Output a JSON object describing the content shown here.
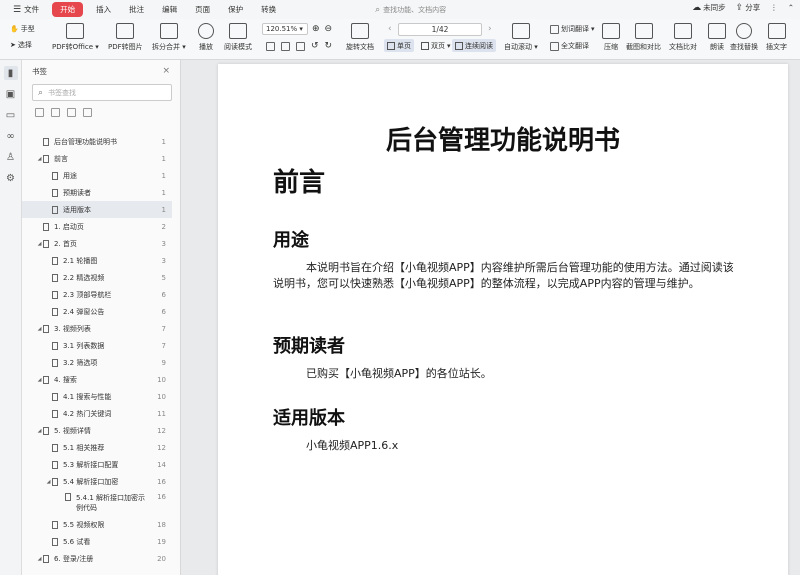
{
  "menubar": {
    "items": [
      "文件",
      "开始",
      "插入",
      "批注",
      "编辑",
      "页面",
      "保护",
      "转换"
    ],
    "active_index": 1,
    "search_text": "查找功能、文档内容",
    "sync_label": "未同步",
    "share_label": "分享"
  },
  "toolbar": {
    "hand_label": "手型",
    "select_label": "选择",
    "pdf_to_office": "PDF转Office",
    "pdf_to_image": "PDF转图片",
    "split_merge": "拆分合并",
    "play": "播放",
    "read_mode": "阅读模式",
    "zoom": "120.51%",
    "rotate_doc": "旋转文档",
    "single_page": "单页",
    "two_page": "双页",
    "continuous": "连续阅读",
    "page_indicator": "1/42",
    "auto_scroll": "自动滚动",
    "translate": "划词翻译",
    "full_translate": "全文翻译",
    "compress": "压缩",
    "screenshot_compare": "截图和对比",
    "doc_compare": "文档比对",
    "read_aloud": "朗读",
    "find_replace": "查找替换",
    "insert_text": "插文字"
  },
  "panel": {
    "title": "书签",
    "search_placeholder": "书签查找"
  },
  "outline": [
    {
      "label": "后台管理功能说明书",
      "page": "1",
      "level": 0,
      "toggle": ""
    },
    {
      "label": "前言",
      "page": "1",
      "level": 0,
      "toggle": "◢"
    },
    {
      "label": "用途",
      "page": "1",
      "level": 1,
      "toggle": ""
    },
    {
      "label": "预期读者",
      "page": "1",
      "level": 1,
      "toggle": ""
    },
    {
      "label": "适用版本",
      "page": "1",
      "level": 1,
      "toggle": "",
      "selected": true
    },
    {
      "label": "1. 启动页",
      "page": "2",
      "level": 0,
      "toggle": ""
    },
    {
      "label": "2. 首页",
      "page": "3",
      "level": 0,
      "toggle": "◢"
    },
    {
      "label": "2.1 轮播图",
      "page": "3",
      "level": 1,
      "toggle": ""
    },
    {
      "label": "2.2 精选视频",
      "page": "5",
      "level": 1,
      "toggle": ""
    },
    {
      "label": "2.3 顶部导航栏",
      "page": "6",
      "level": 1,
      "toggle": ""
    },
    {
      "label": "2.4 弹窗公告",
      "page": "6",
      "level": 1,
      "toggle": ""
    },
    {
      "label": "3. 视频列表",
      "page": "7",
      "level": 0,
      "toggle": "◢"
    },
    {
      "label": "3.1 列表数据",
      "page": "7",
      "level": 1,
      "toggle": ""
    },
    {
      "label": "3.2 筛选项",
      "page": "9",
      "level": 1,
      "toggle": ""
    },
    {
      "label": "4. 搜索",
      "page": "10",
      "level": 0,
      "toggle": "◢"
    },
    {
      "label": "4.1 搜索与性能",
      "page": "10",
      "level": 1,
      "toggle": ""
    },
    {
      "label": "4.2 热门关键词",
      "page": "11",
      "level": 1,
      "toggle": ""
    },
    {
      "label": "5. 视频详情",
      "page": "12",
      "level": 0,
      "toggle": "◢"
    },
    {
      "label": "5.1 相关推荐",
      "page": "12",
      "level": 1,
      "toggle": ""
    },
    {
      "label": "5.3 解析接口配置",
      "page": "14",
      "level": 1,
      "toggle": ""
    },
    {
      "label": "5.4 解析接口加密",
      "page": "16",
      "level": 1,
      "toggle": "◢"
    },
    {
      "label": "5.4.1 解析接口加密示例代码",
      "page": "16",
      "level": 2,
      "toggle": "",
      "tall": true
    },
    {
      "label": "5.5 视频权限",
      "page": "18",
      "level": 1,
      "toggle": ""
    },
    {
      "label": "5.6 试看",
      "page": "19",
      "level": 1,
      "toggle": ""
    },
    {
      "label": "6. 登录/注册",
      "page": "20",
      "level": 0,
      "toggle": "◢"
    }
  ],
  "document": {
    "title": "后台管理功能说明书",
    "h_preface": "前言",
    "h_purpose": "用途",
    "p_purpose": "本说明书旨在介绍【小龟视频APP】内容维护所需后台管理功能的使用方法。通过阅读该说明书，您可以快速熟悉【小龟视频APP】的整体流程，以完成APP内容的管理与维护。",
    "h_readers": "预期读者",
    "p_readers": "已购买【小龟视频APP】的各位站长。",
    "h_version": "适用版本",
    "p_version": "小龟视频APP1.6.x"
  }
}
